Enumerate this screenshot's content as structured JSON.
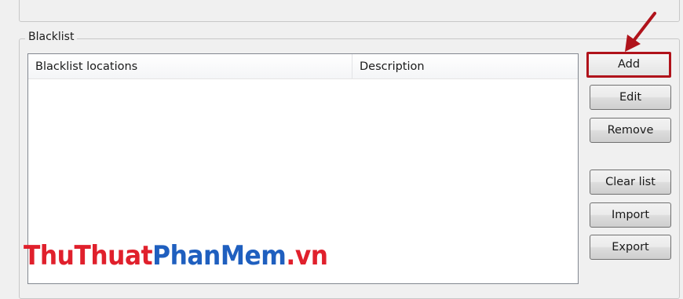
{
  "groupbox": {
    "title": "Blacklist"
  },
  "table": {
    "columns": [
      "Blacklist locations",
      "Description"
    ],
    "rows": []
  },
  "buttons": {
    "add": "Add",
    "edit": "Edit",
    "remove": "Remove",
    "clear_list": "Clear list",
    "import": "Import",
    "export": "Export"
  },
  "annotation": {
    "highlight_color": "#b0131b",
    "target": "Add"
  },
  "watermark": {
    "part1": "ThuThuat",
    "part2": "PhanMem",
    "part3": ".vn",
    "color_red": "#e0202c",
    "color_blue": "#1f5fbf"
  }
}
